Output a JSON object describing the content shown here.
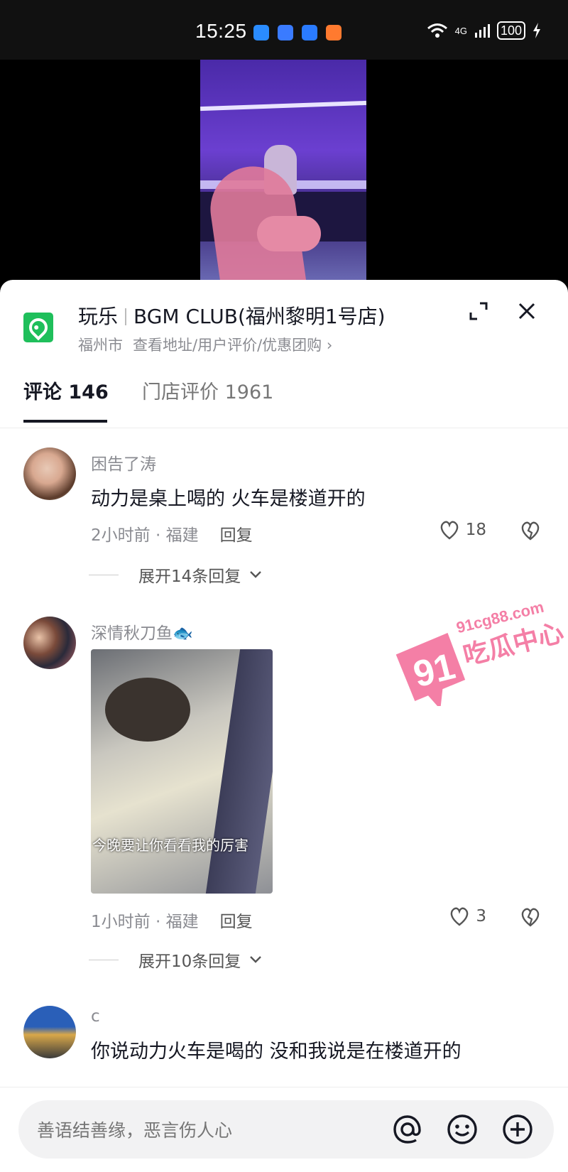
{
  "status_bar": {
    "time": "15:25",
    "network": "4G",
    "battery": "100",
    "notification_icons": [
      "message-app-icon",
      "signal-app-icon",
      "cube-app-icon",
      "orange-app-icon"
    ],
    "notification_colors": [
      "#2a8cff",
      "#3a7bff",
      "#2a7bff",
      "#ff7a2f"
    ]
  },
  "poi": {
    "category": "玩乐",
    "name": "BGM CLUB(福州黎明1号店)",
    "city": "福州市",
    "links": "查看地址/用户评价/优惠团购 ›",
    "accent_color": "#1fbf5b"
  },
  "tabs": [
    {
      "label": "评论 146",
      "active": true
    },
    {
      "label": "门店评价 1961",
      "active": false
    }
  ],
  "comments": [
    {
      "username": "困告了涛",
      "text": "动力是桌上喝的 火车是楼道开的",
      "time_location": "2小时前 · 福建",
      "reply_label": "回复",
      "likes": "18",
      "expand_label": "展开14条回复"
    },
    {
      "username": "深情秋刀鱼🐟",
      "image_caption": "今晚要让你看看我的厉害",
      "time_location": "1小时前 · 福建",
      "reply_label": "回复",
      "likes": "3",
      "expand_label": "展开10条回复"
    },
    {
      "username": "c",
      "text": "你说动力火车是喝的 没和我说是在楼道开的"
    }
  ],
  "input": {
    "placeholder": "善语结善缘，恶言伤人心"
  },
  "watermark": {
    "number": "91",
    "domain": "91cg88.com",
    "brand": "吃瓜中心",
    "color": "#f47fa6"
  }
}
